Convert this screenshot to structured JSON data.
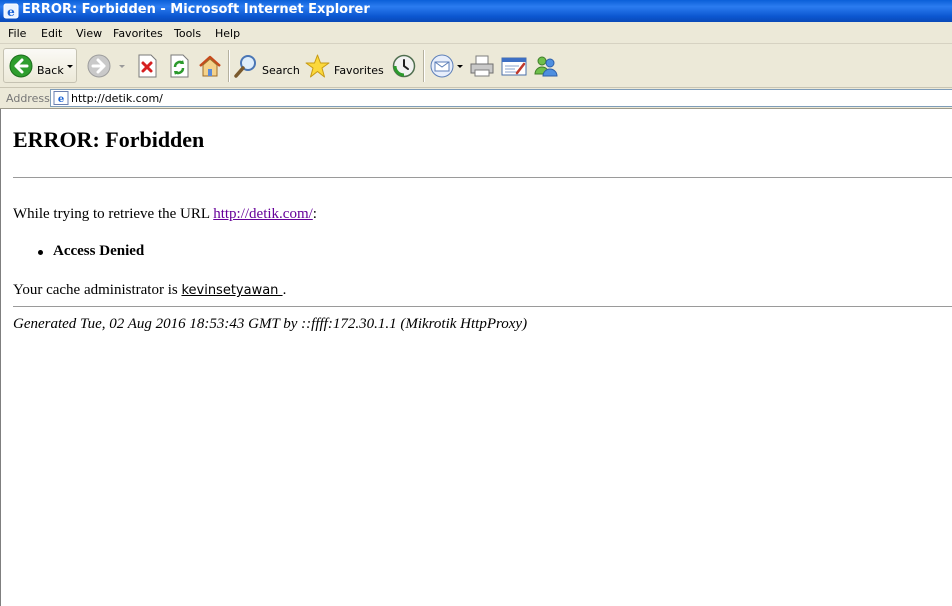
{
  "window": {
    "title": "ERROR: Forbidden - Microsoft Internet Explorer"
  },
  "menu": {
    "items": [
      "File",
      "Edit",
      "View",
      "Favorites",
      "Tools",
      "Help"
    ]
  },
  "toolbar": {
    "back_label": "Back",
    "search_label": "Search",
    "favorites_label": "Favorites",
    "icons": [
      "back-icon",
      "forward-icon",
      "stop-icon",
      "refresh-icon",
      "home-icon",
      "search-icon",
      "favorites-icon",
      "history-icon",
      "mail-icon",
      "print-icon",
      "edit-icon",
      "messenger-icon"
    ]
  },
  "address": {
    "label": "Address",
    "url": "http://detik.com/"
  },
  "page": {
    "heading": "ERROR: Forbidden",
    "retrieve_prefix": "While trying to retrieve the URL ",
    "retrieve_link": "http://detik.com/",
    "retrieve_suffix": ":",
    "error_item": "Access Denied",
    "admin_prefix": "Your cache administrator is ",
    "admin_link": "kevinsetyawan ",
    "admin_suffix": ".",
    "generated": "Generated Tue, 02 Aug 2016 18:53:43 GMT by ::ffff:172.30.1.1 (Mikrotik HttpProxy)"
  },
  "colors": {
    "titlebar": "#0b56d0",
    "chrome": "#ece9d8",
    "visited_link": "#660099"
  }
}
